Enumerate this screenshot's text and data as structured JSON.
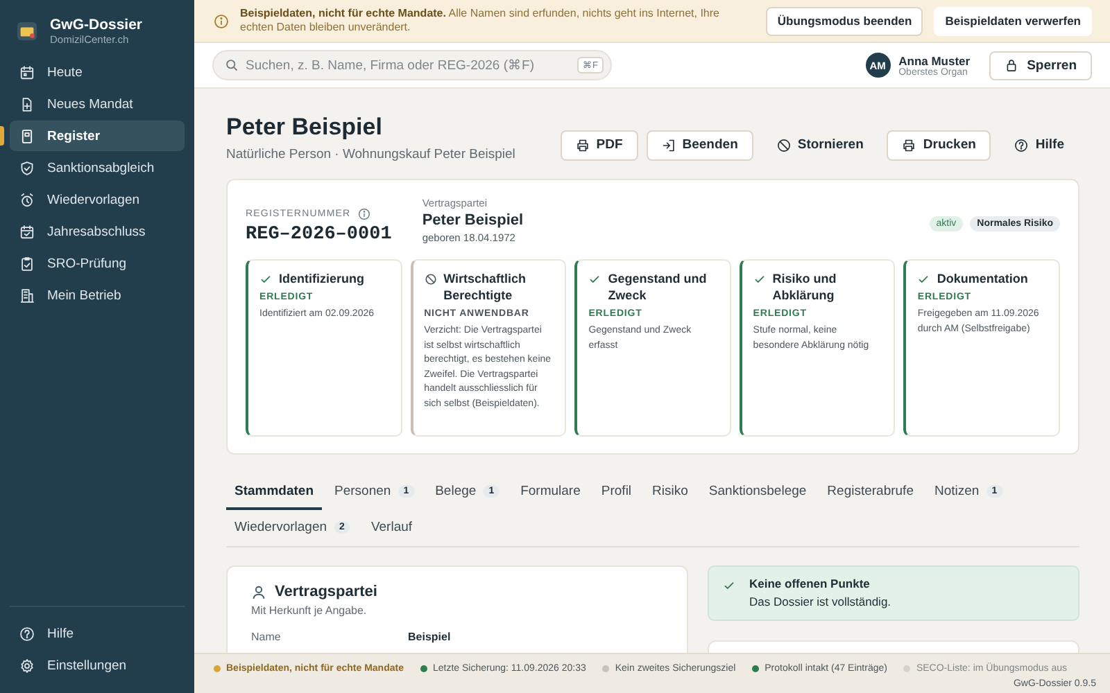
{
  "app": {
    "title": "GwG-Dossier",
    "subtitle": "DomizilCenter.ch"
  },
  "sidebar": {
    "items": [
      {
        "label": "Heute",
        "selected": false
      },
      {
        "label": "Neues Mandat",
        "selected": false
      },
      {
        "label": "Register",
        "selected": true
      },
      {
        "label": "Sanktionsabgleich",
        "selected": false
      },
      {
        "label": "Wiedervorlagen",
        "selected": false
      },
      {
        "label": "Jahresabschluss",
        "selected": false
      },
      {
        "label": "SRO-Prüfung",
        "selected": false
      },
      {
        "label": "Mein Betrieb",
        "selected": false
      }
    ],
    "footer_items": [
      {
        "label": "Hilfe"
      },
      {
        "label": "Einstellungen"
      }
    ]
  },
  "banner": {
    "text": "**Beispieldaten, nicht für echte Mandate.** Alle Namen sind erfunden, nichts geht ins Internet, Ihre echten Daten bleiben unverändert.",
    "buttons": [
      "Übungsmodus beenden",
      "Beispieldaten verwerfen"
    ]
  },
  "search": {
    "placeholder": "Suchen, z. B. Name, Firma oder REG-2026 (⌘F)",
    "shortcut": "⌘F"
  },
  "user": {
    "initials": "AM",
    "name": "Anna Muster",
    "role": "Oberstes Organ"
  },
  "lock_button": "Sperren",
  "page": {
    "title": "Peter Beispiel",
    "subtitle": "Natürliche Person · Wohnungskauf Peter Beispiel",
    "actions": [
      {
        "label": "PDF",
        "outlined": true
      },
      {
        "label": "Beenden",
        "outlined": true
      },
      {
        "label": "Stornieren",
        "outlined": false
      },
      {
        "label": "Drucken",
        "outlined": true
      },
      {
        "label": "Hilfe",
        "outlined": false
      }
    ]
  },
  "summary": {
    "register_label": "REGISTERNUMMER",
    "register_number": "REG–2026–0001",
    "party_label": "Vertragspartei",
    "party_name": "Peter Beispiel",
    "party_born": "geboren 18.04.1972",
    "badges": [
      {
        "label": "aktiv",
        "kind": "status"
      },
      {
        "label": "Normales Risiko",
        "kind": "risk"
      }
    ],
    "steps": [
      {
        "title": "Identifizierung",
        "kind": "done",
        "status": "ERLEDIGT",
        "text": "Identifiziert am 02.09.2026"
      },
      {
        "title": "Wirtschaftlich Berechtigte",
        "kind": "not_applicable",
        "status": "NICHT ANWENDBAR",
        "text": "Verzicht: Die Vertragspartei ist selbst wirtschaftlich berechtigt, es bestehen keine Zweifel. Die Vertragspartei handelt ausschliesslich für sich selbst (Beispieldaten)."
      },
      {
        "title": "Gegenstand und Zweck",
        "kind": "done",
        "status": "ERLEDIGT",
        "text": "Gegenstand und Zweck erfasst"
      },
      {
        "title": "Risiko und Abklärung",
        "kind": "done",
        "status": "ERLEDIGT",
        "text": "Stufe normal, keine besondere Abklärung nötig"
      },
      {
        "title": "Dokumentation",
        "kind": "done",
        "status": "ERLEDIGT",
        "text": "Freigegeben am 11.09.2026 durch AM (Selbstfreigabe)"
      }
    ]
  },
  "tabs": [
    {
      "label": "Stammdaten",
      "selected": true
    },
    {
      "label": "Personen",
      "count": "1",
      "selected": false
    },
    {
      "label": "Belege",
      "count": "1",
      "selected": false
    },
    {
      "label": "Formulare",
      "selected": false
    },
    {
      "label": "Profil",
      "selected": false
    },
    {
      "label": "Risiko",
      "selected": false
    },
    {
      "label": "Sanktionsbelege",
      "selected": false
    },
    {
      "label": "Registerabrufe",
      "selected": false
    },
    {
      "label": "Notizen",
      "count": "1",
      "selected": false
    },
    {
      "label": "Wiedervorlagen",
      "count": "2",
      "selected": false
    },
    {
      "label": "Verlauf",
      "selected": false
    }
  ],
  "party_card": {
    "title": "Vertragspartei",
    "subtitle": "Mit Herkunft je Angabe.",
    "fields": [
      {
        "label": "Name",
        "value": "Beispiel"
      }
    ]
  },
  "notice": {
    "title": "Keine offenen Punkte",
    "text": "Das Dossier ist vollständig."
  },
  "status_bar": {
    "items": [
      {
        "label": "Beispieldaten, nicht für echte Mandate",
        "color": "#d9a53a",
        "kind": "warning"
      },
      {
        "label": "Letzte Sicherung: 11.09.2026 20:33",
        "color": "#2e7d4f",
        "kind": "normal"
      },
      {
        "label": "Kein zweites Sicherungsziel",
        "color": "#c7c2ba",
        "kind": "normal"
      },
      {
        "label": "Protokoll intakt (47 Einträge)",
        "color": "#2e7d4f",
        "kind": "normal"
      },
      {
        "label": "SECO-Liste: im Übungsmodus aus",
        "color": "#d6d2cb",
        "kind": "muted"
      }
    ],
    "version": "GwG-Dossier 0.9.5"
  }
}
